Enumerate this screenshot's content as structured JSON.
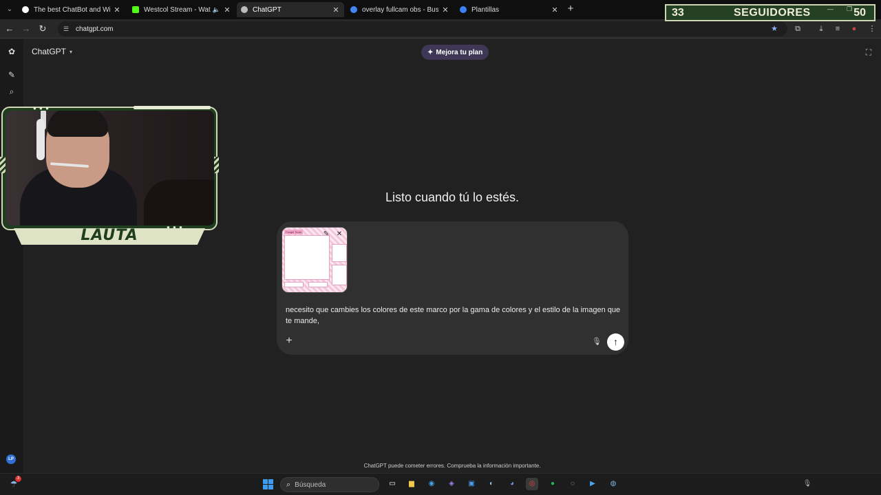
{
  "browser": {
    "tabs": [
      {
        "title": "The best ChatBot and Widgets",
        "favicon_color": "#ffffff"
      },
      {
        "title": "Westcol Stream - Watch Li",
        "favicon_color": "#53fc18"
      },
      {
        "title": "ChatGPT",
        "favicon_color": "#bbbbbb"
      },
      {
        "title": "overlay fullcam obs - Buscar co",
        "favicon_color": "#4285f4"
      },
      {
        "title": "Plantillas",
        "favicon_color": "#3b82f6"
      }
    ],
    "url": "chatgpt.com"
  },
  "counter": {
    "current": "33",
    "label": "SEGUIDORES",
    "goal": "50"
  },
  "app": {
    "model": "ChatGPT",
    "plan_button": "Mejora tu plan",
    "hero": "Listo cuando tú lo estés.",
    "attachment": {
      "label": "Fangirl Team"
    },
    "prompt_text": "necesito que cambies los colores de este marco por la gama de colores y el estilo de la imagen que te mande,",
    "disclaimer": "ChatGPT puede cometer errores. Comprueba la información importante.",
    "user_initials": "LP"
  },
  "webcam": {
    "name": "LAUTA"
  },
  "taskbar": {
    "search_placeholder": "Búsqueda",
    "notification_count": "3"
  },
  "colors": {
    "background": "#212121",
    "composer": "#303030",
    "plan_button": "#3e3856",
    "overlay_green": "#1f3d1f",
    "overlay_cream": "#d3d9b8"
  }
}
